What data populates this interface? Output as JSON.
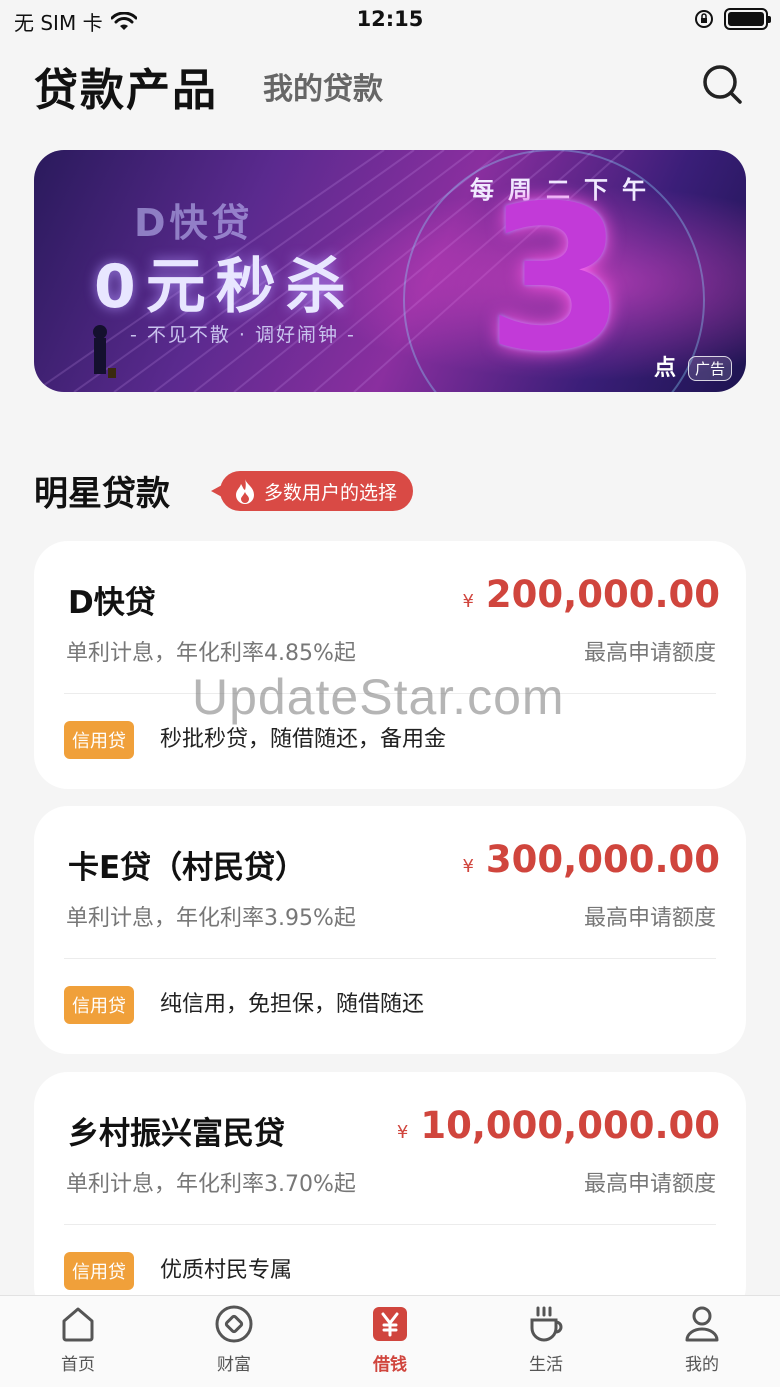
{
  "status_bar": {
    "carrier": "无 SIM 卡",
    "time": "12:15"
  },
  "header": {
    "tab_active": "贷款产品",
    "tab_inactive": "我的贷款",
    "search_icon": "search-icon"
  },
  "banner": {
    "subtitle": "D快贷",
    "main": "0元秒杀",
    "tagline": "- 不见不散 · 调好闹钟 -",
    "week": "每周二下午",
    "time_digit": "3",
    "time_suffix": "点",
    "ad_label": "广告"
  },
  "section": {
    "title": "明星贷款",
    "badge": "多数用户的选择",
    "badge_icon": "flame-icon"
  },
  "loans": [
    {
      "name": "D快贷",
      "currency": "¥",
      "amount": "200,000.00",
      "rate": "单利计息，年化利率4.85%起",
      "limit_label": "最高申请额度",
      "tag": "信用贷",
      "desc": "秒批秒贷，随借随还，备用金"
    },
    {
      "name": "卡E贷（村民贷）",
      "currency": "¥",
      "amount": "300,000.00",
      "rate": "单利计息，年化利率3.95%起",
      "limit_label": "最高申请额度",
      "tag": "信用贷",
      "desc": "纯信用，免担保，随借随还"
    },
    {
      "name": "乡村振兴富民贷",
      "currency": "¥",
      "amount": "10,000,000.00",
      "rate": "单利计息，年化利率3.70%起",
      "limit_label": "最高申请额度",
      "tag": "信用贷",
      "desc": "优质村民专属"
    }
  ],
  "watermark": "UpdateStar.com",
  "tabbar": {
    "items": [
      {
        "label": "首页",
        "icon": "home-icon"
      },
      {
        "label": "财富",
        "icon": "wealth-icon"
      },
      {
        "label": "借钱",
        "icon": "yen-icon",
        "active": true
      },
      {
        "label": "生活",
        "icon": "coffee-icon"
      },
      {
        "label": "我的",
        "icon": "profile-icon"
      }
    ]
  },
  "colors": {
    "accent": "#d0453d",
    "tag": "#f0a03a",
    "badge": "#d94a45"
  }
}
